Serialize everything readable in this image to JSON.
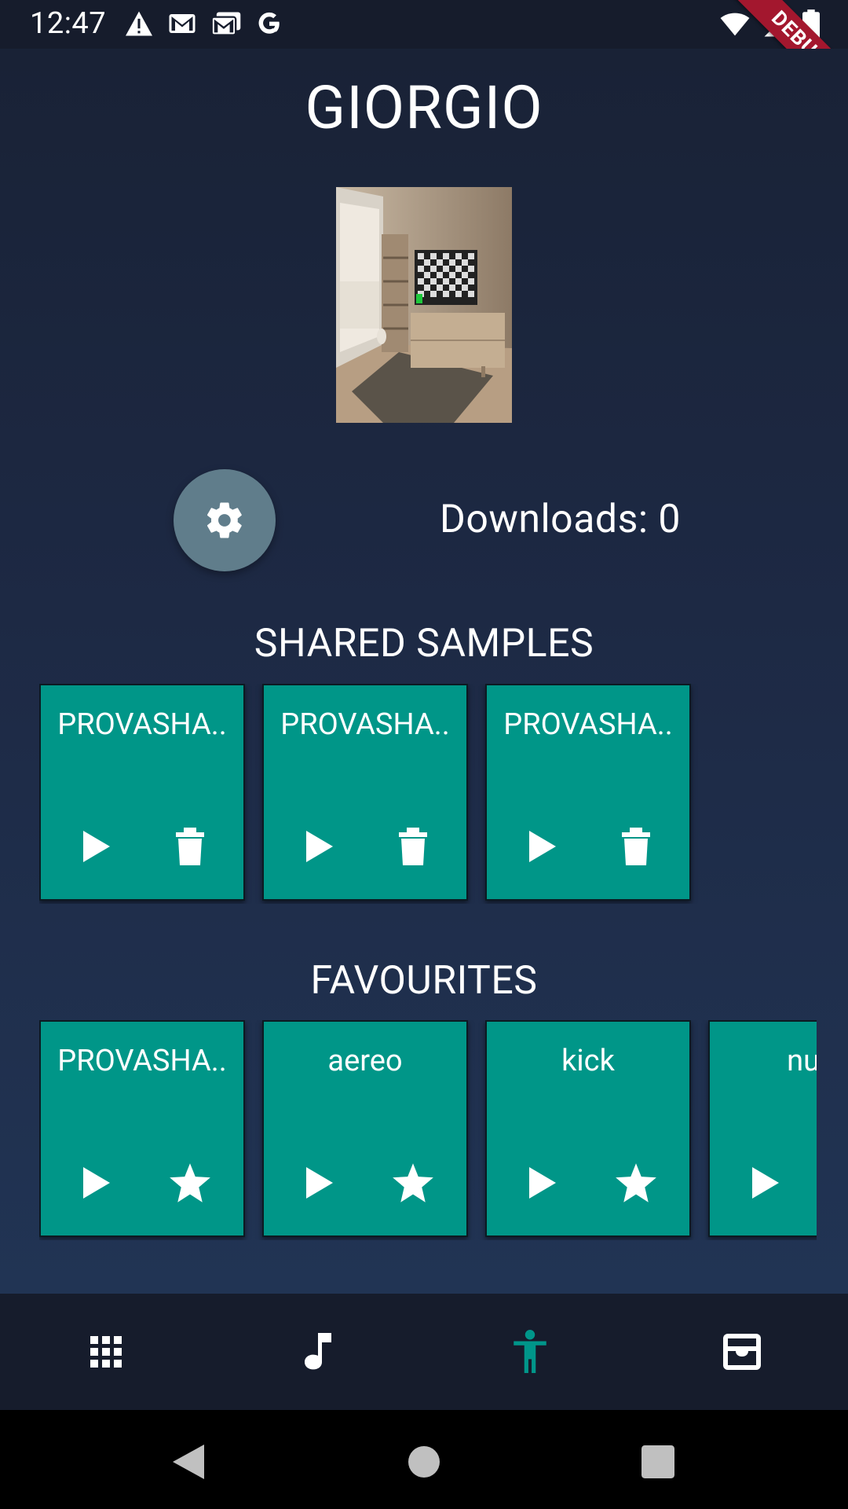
{
  "status_bar": {
    "time": "12:47",
    "left_icons": [
      "warning-icon",
      "gmail-icon",
      "gmail-stack-icon",
      "google-icon"
    ],
    "right_icons": [
      "wifi-icon",
      "signal-icon",
      "battery-icon"
    ],
    "debug_label": "DEBUG"
  },
  "profile": {
    "name": "GIORGIO",
    "downloads_label": "Downloads: 0"
  },
  "shared": {
    "title": "SHARED SAMPLES",
    "items": [
      {
        "label": "PROVASHA.."
      },
      {
        "label": "PROVASHA.."
      },
      {
        "label": "PROVASHA.."
      }
    ]
  },
  "favourites": {
    "title": "FAVOURITES",
    "items": [
      {
        "label": "PROVASHA.."
      },
      {
        "label": "aereo"
      },
      {
        "label": "kick"
      },
      {
        "label": "nuc"
      }
    ]
  },
  "nav": {
    "items": [
      "grid-icon",
      "music-note-icon",
      "accessibility-icon",
      "inbox-icon"
    ],
    "active_index": 2,
    "active_color": "#00968a",
    "inactive_color": "#ffffff"
  },
  "colors": {
    "card": "#009688",
    "settings_button": "#607d8b",
    "background": "#1a2238"
  }
}
